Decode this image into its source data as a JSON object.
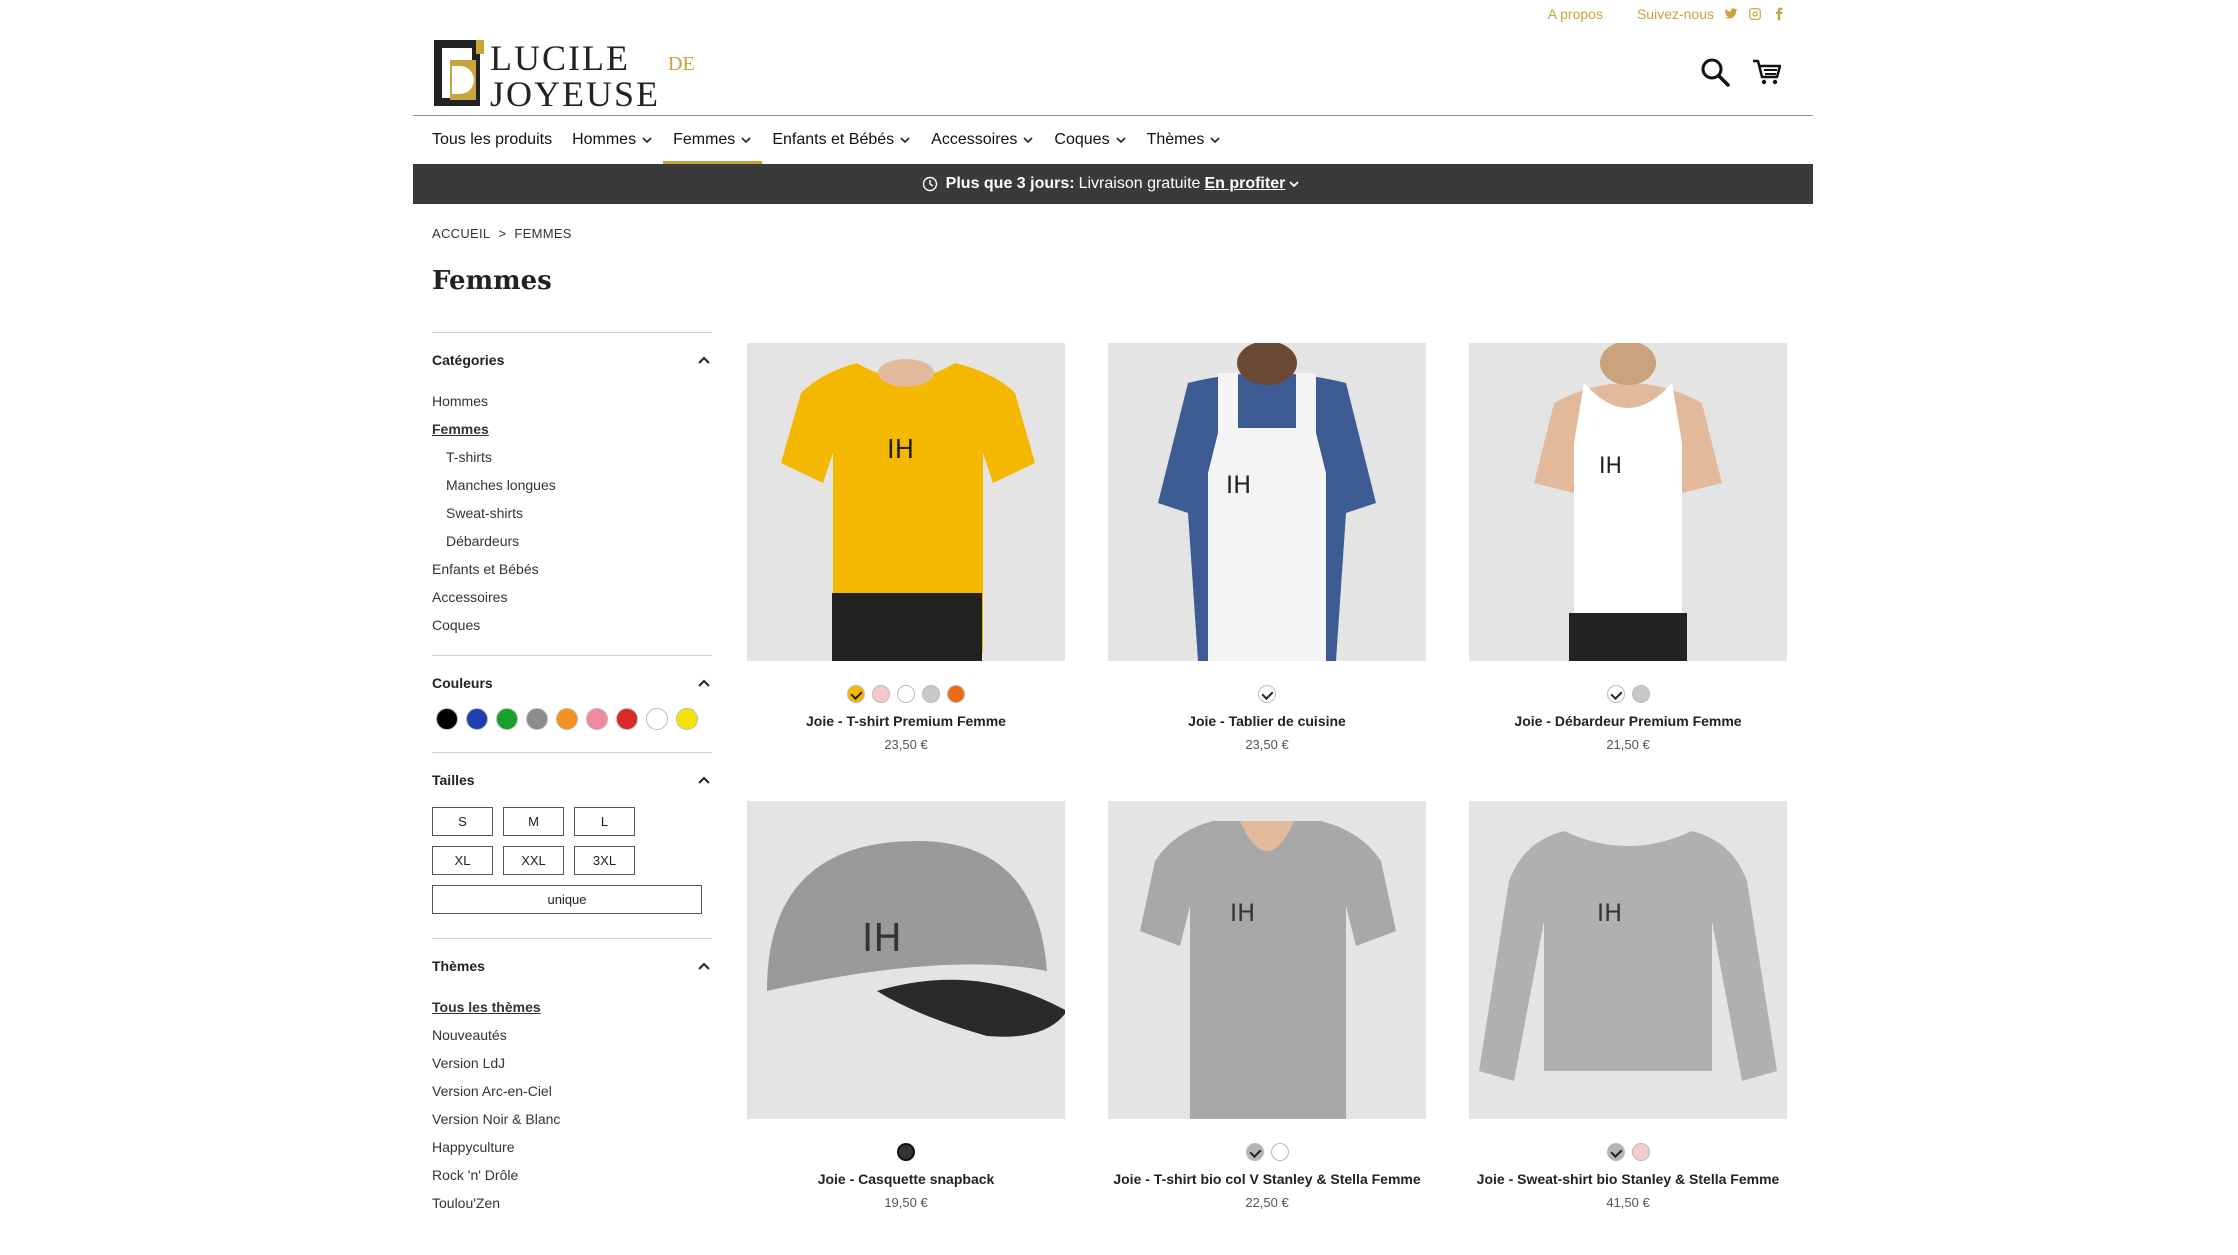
{
  "toplinks": {
    "about": "A propos",
    "follow": "Suivez-nous"
  },
  "brand": {
    "line1": "LUCILE",
    "de": "DE",
    "line2": "JOYEUSE",
    "accent": "#c9a43b"
  },
  "nav": [
    {
      "label": "Tous les produits"
    },
    {
      "label": "Hommes"
    },
    {
      "label": "Femmes"
    },
    {
      "label": "Enfants et Bébés"
    },
    {
      "label": "Accessoires"
    },
    {
      "label": "Coques"
    },
    {
      "label": "Thèmes"
    }
  ],
  "promo": {
    "bold": "Plus que 3 jours:",
    "text": "Livraison gratuite",
    "link": "En profiter"
  },
  "breadcrumb": {
    "home": "ACCUEIL",
    "sep": ">",
    "current": "FEMMES"
  },
  "page_title": "Femmes",
  "filters": {
    "categories": {
      "title": "Catégories",
      "items": [
        "Hommes",
        "Femmes",
        "T-shirts",
        "Manches longues",
        "Sweat-shirts",
        "Débardeurs",
        "Enfants et Bébés",
        "Accessoires",
        "Coques"
      ]
    },
    "colors": {
      "title": "Couleurs",
      "swatches": [
        "#000000",
        "#1f3fae",
        "#17a02b",
        "#8c8c8c",
        "#f5911e",
        "#f08aa0",
        "#d92a2a",
        "#ffffff",
        "#f5e400"
      ]
    },
    "sizes": {
      "title": "Tailles",
      "items": [
        "S",
        "M",
        "L",
        "XL",
        "XXL",
        "3XL"
      ],
      "wide": "unique"
    },
    "themes": {
      "title": "Thèmes",
      "items": [
        "Tous les thèmes",
        "Nouveautés",
        "Version LdJ",
        "Version Arc-en-Ciel",
        "Version Noir & Blanc",
        "Happyculture",
        "Rock 'n' Drôle",
        "Toulou'Zen"
      ]
    }
  },
  "products": [
    {
      "name": "Joie - T-shirt Premium Femme",
      "price": "23,50 €",
      "colors": [
        "#f5b800",
        "#f6c6cc",
        "#ffffff",
        "#c8c8c8",
        "#ee6a12"
      ]
    },
    {
      "name": "Joie - Tablier de cuisine",
      "price": "23,50 €",
      "colors": [
        "#ffffff"
      ]
    },
    {
      "name": "Joie - Débardeur Premium Femme",
      "price": "21,50 €",
      "colors": [
        "#ffffff",
        "#c8c8c8"
      ]
    },
    {
      "name": "Joie - Casquette snapback",
      "price": "19,50 €",
      "colors": [
        "#333333"
      ]
    },
    {
      "name": "Joie - T-shirt bio col V Stanley & Stella Femme",
      "price": "22,50 €",
      "colors": [
        "#b5b5b5",
        "#ffffff"
      ]
    },
    {
      "name": "Joie - Sweat-shirt bio Stanley & Stella Femme",
      "price": "41,50 €",
      "colors": [
        "#b5b5b5",
        "#f1cdd0"
      ]
    }
  ]
}
